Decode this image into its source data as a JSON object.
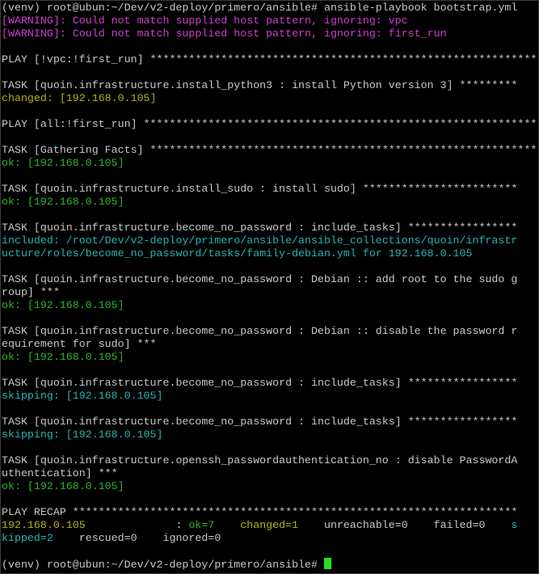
{
  "terminal": {
    "lines": [
      [
        {
          "t": "(venv) root@ubun:~/Dev/v2-deploy/primero/ansible# ansible-playbook bootstrap.yml",
          "c": "text"
        }
      ],
      [
        {
          "t": "[WARNING]: Could not match supplied host pattern, ignoring: vpc",
          "c": "warn"
        }
      ],
      [
        {
          "t": "[WARNING]: Could not match supplied host pattern, ignoring: first_run",
          "c": "warn"
        }
      ],
      [],
      [
        {
          "t": "PLAY [!vpc:!first_run] *************************************************************",
          "c": "text"
        }
      ],
      [],
      [
        {
          "t": "TASK [quoin.infrastructure.install_python3 : install Python version 3] *********",
          "c": "text"
        }
      ],
      [
        {
          "t": "changed: [192.168.0.105]",
          "c": "changed"
        }
      ],
      [],
      [
        {
          "t": "PLAY [all:!first_run] **************************************************************",
          "c": "text"
        }
      ],
      [],
      [
        {
          "t": "TASK [Gathering Facts] *************************************************************",
          "c": "text"
        }
      ],
      [
        {
          "t": "ok: [192.168.0.105]",
          "c": "ok"
        }
      ],
      [],
      [
        {
          "t": "TASK [quoin.infrastructure.install_sudo : install sudo] ************************",
          "c": "text"
        }
      ],
      [
        {
          "t": "ok: [192.168.0.105]",
          "c": "ok"
        }
      ],
      [],
      [
        {
          "t": "TASK [quoin.infrastructure.become_no_password : include_tasks] *****************",
          "c": "text"
        }
      ],
      [
        {
          "t": "included: /root/Dev/v2-deploy/primero/ansible/ansible_collections/quoin/infrastr",
          "c": "cyan"
        }
      ],
      [
        {
          "t": "ucture/roles/become_no_password/tasks/family-debian.yml for 192.168.0.105",
          "c": "cyan"
        }
      ],
      [],
      [
        {
          "t": "TASK [quoin.infrastructure.become_no_password : Debian :: add root to the sudo g",
          "c": "text"
        }
      ],
      [
        {
          "t": "roup] ***",
          "c": "text"
        }
      ],
      [
        {
          "t": "ok: [192.168.0.105]",
          "c": "ok"
        }
      ],
      [],
      [
        {
          "t": "TASK [quoin.infrastructure.become_no_password : Debian :: disable the password r",
          "c": "text"
        }
      ],
      [
        {
          "t": "equirement for sudo] ***",
          "c": "text"
        }
      ],
      [
        {
          "t": "ok: [192.168.0.105]",
          "c": "ok"
        }
      ],
      [],
      [
        {
          "t": "TASK [quoin.infrastructure.become_no_password : include_tasks] *****************",
          "c": "text"
        }
      ],
      [
        {
          "t": "skipping: [192.168.0.105]",
          "c": "cyan"
        }
      ],
      [],
      [
        {
          "t": "TASK [quoin.infrastructure.become_no_password : include_tasks] *****************",
          "c": "text"
        }
      ],
      [
        {
          "t": "skipping: [192.168.0.105]",
          "c": "cyan"
        }
      ],
      [],
      [
        {
          "t": "TASK [quoin.infrastructure.openssh_passwordauthentication_no : disable PasswordA",
          "c": "text"
        }
      ],
      [
        {
          "t": "uthentication] ***",
          "c": "text"
        }
      ],
      [
        {
          "t": "ok: [192.168.0.105]",
          "c": "ok"
        }
      ],
      [],
      [
        {
          "t": "PLAY RECAP *********************************************************************",
          "c": "text"
        }
      ],
      [
        {
          "t": "192.168.0.105",
          "c": "changed"
        },
        {
          "t": "              : ",
          "c": "text"
        },
        {
          "t": "ok=7",
          "c": "ok"
        },
        {
          "t": "    ",
          "c": "text"
        },
        {
          "t": "changed=1",
          "c": "changed"
        },
        {
          "t": "    unreachable=0    failed=0    ",
          "c": "text"
        },
        {
          "t": "s",
          "c": "cyan"
        }
      ],
      [
        {
          "t": "kipped=2",
          "c": "cyan"
        },
        {
          "t": "    rescued=0    ignored=0",
          "c": "text"
        }
      ],
      [],
      [
        {
          "t": "(venv) root@ubun:~/Dev/v2-deploy/primero/ansible# ",
          "c": "text"
        }
      ]
    ]
  }
}
